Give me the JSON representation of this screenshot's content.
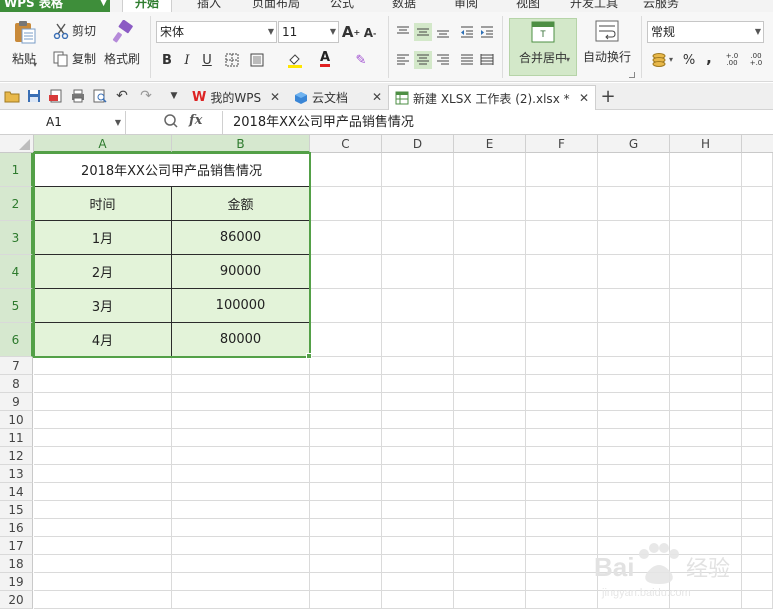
{
  "menubar": {
    "app_label": "WPS 表格",
    "tabs": [
      "开始",
      "插入",
      "页面布局",
      "公式",
      "数据",
      "审阅",
      "视图",
      "开发工具",
      "云服务"
    ],
    "active_tab": "开始"
  },
  "ribbon": {
    "paste": "粘贴",
    "cut": "剪切",
    "copy": "复制",
    "format_painter": "格式刷",
    "font_name": "宋体",
    "font_size": "11",
    "merge_center": "合并居中",
    "wrap_text": "自动换行",
    "number_format": "常规",
    "percent": "%",
    "comma": ",",
    "inc_decimal": "+.0 .00",
    "dec_decimal": ".00 +.0"
  },
  "tabbar": {
    "tabs": [
      {
        "label": "我的WPS",
        "icon": "wps-logo-icon"
      },
      {
        "label": "云文档",
        "icon": "cloud-cube-icon"
      },
      {
        "label": "新建 XLSX 工作表 (2).xlsx *",
        "icon": "spreadsheet-file-icon"
      }
    ],
    "add_tab": "+"
  },
  "formula_bar": {
    "name_box": "A1",
    "fx_label": "fx",
    "content": "2018年XX公司甲产品销售情况"
  },
  "sheet": {
    "columns": [
      "A",
      "B",
      "C",
      "D",
      "E",
      "F",
      "G",
      "H"
    ],
    "rows": [
      "1",
      "2",
      "3",
      "4",
      "5",
      "6",
      "7",
      "8",
      "9",
      "10",
      "11",
      "12",
      "13",
      "14",
      "15",
      "16",
      "17",
      "18",
      "19",
      "20"
    ],
    "title": "2018年XX公司甲产品销售情况",
    "headers": [
      "时间",
      "金额"
    ],
    "data": [
      [
        "1月",
        "86000"
      ],
      [
        "2月",
        "90000"
      ],
      [
        "3月",
        "100000"
      ],
      [
        "4月",
        "80000"
      ]
    ]
  },
  "colors": {
    "accent_green": "#53a047",
    "table_fill": "#e3f3d9",
    "header_selected": "#d6e8cf"
  }
}
